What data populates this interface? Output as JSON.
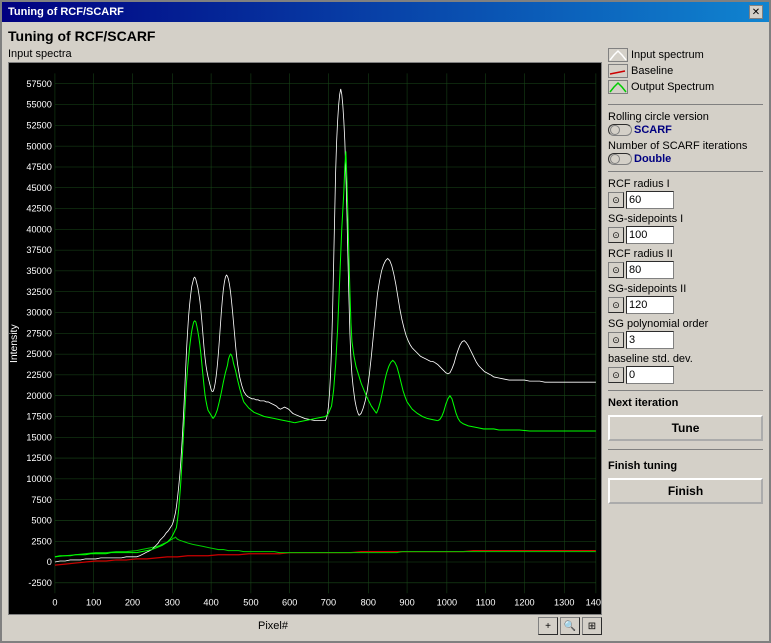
{
  "window": {
    "title": "Tuning of RCF/SCARF",
    "close_label": "✕"
  },
  "page": {
    "title": "Tuning of RCF/SCARF",
    "chart_section_label": "Input spectra",
    "x_axis_label": "Pixel#",
    "y_axis_label": "Intensity"
  },
  "legend": {
    "items": [
      {
        "label": "Input spectrum"
      },
      {
        "label": "Baseline"
      },
      {
        "label": "Output Spectrum"
      }
    ]
  },
  "controls": {
    "rolling_circle": {
      "label": "Rolling circle version",
      "value": "SCARF"
    },
    "scarf_iterations": {
      "label": "Number of SCARF iterations",
      "value": "Double"
    },
    "rcf_radius_i": {
      "label": "RCF radius I",
      "value": "60"
    },
    "sg_sidepoints_i": {
      "label": "SG-sidepoints I",
      "value": "100"
    },
    "rcf_radius_ii": {
      "label": "RCF radius II",
      "value": "80"
    },
    "sg_sidepoints_ii": {
      "label": "SG-sidepoints II",
      "value": "120"
    },
    "sg_poly_order": {
      "label": "SG polynomial order",
      "value": "3"
    },
    "baseline_std_dev": {
      "label": "baseline std. dev.",
      "value": "0"
    }
  },
  "buttons": {
    "tune": "Tune",
    "finish": "Finish",
    "next_iteration": "Next iteration",
    "finish_tuning": "Finish tuning"
  },
  "chart": {
    "y_ticks": [
      "-2500",
      "0",
      "2500",
      "5000",
      "7500",
      "10000",
      "12500",
      "15000",
      "17500",
      "20000",
      "22500",
      "25000",
      "27500",
      "30000",
      "32500",
      "35000",
      "37500",
      "40000",
      "42500",
      "45000",
      "47500",
      "50000",
      "52500",
      "55000",
      "57500"
    ],
    "x_ticks": [
      "0",
      "100",
      "200",
      "300",
      "400",
      "500",
      "600",
      "700",
      "800",
      "900",
      "1000",
      "1100",
      "1200",
      "1300",
      "1400"
    ]
  }
}
